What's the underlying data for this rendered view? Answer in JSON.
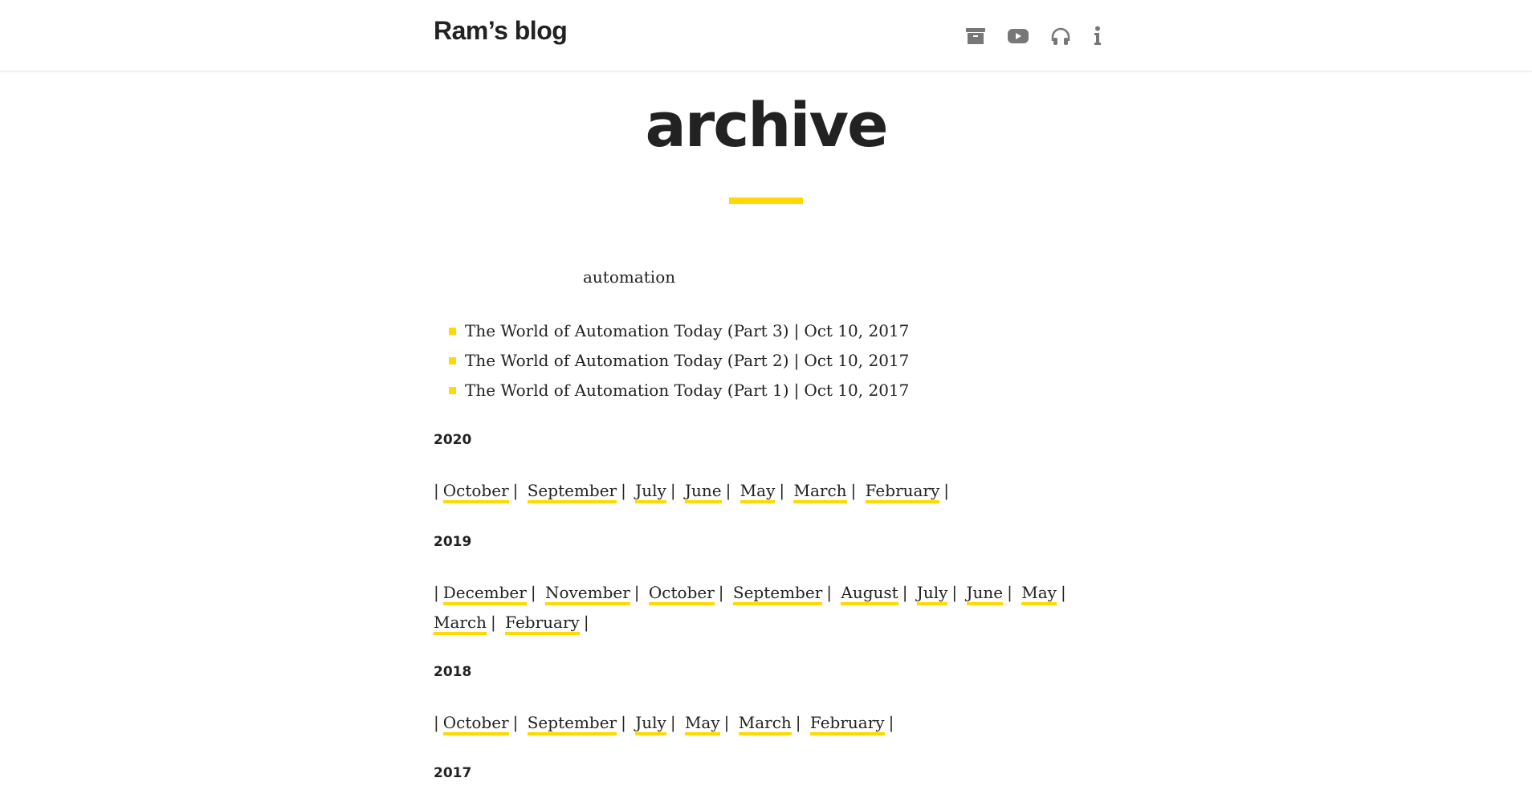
{
  "header": {
    "site_title": "Ram’s blog",
    "nav_icons": [
      {
        "name": "archive-icon",
        "label": "Archive"
      },
      {
        "name": "youtube-icon",
        "label": "YouTube"
      },
      {
        "name": "headphones-icon",
        "label": "Podcast"
      },
      {
        "name": "info-icon",
        "label": "About"
      }
    ],
    "icon_color": "#777777"
  },
  "page": {
    "title": "archive",
    "accent_color": "#ffd900"
  },
  "tag_section": {
    "label": "automation",
    "posts": [
      {
        "title": "The World of Automation Today (Part 3)",
        "date": "Oct 10, 2017"
      },
      {
        "title": "The World of Automation Today (Part 2)",
        "date": "Oct 10, 2017"
      },
      {
        "title": "The World of Automation Today (Part 1)",
        "date": "Oct 10, 2017"
      }
    ],
    "separator": "|"
  },
  "years": [
    {
      "year": "2020",
      "months": [
        "October",
        "September",
        "July",
        "June",
        "May",
        "March",
        "February"
      ]
    },
    {
      "year": "2019",
      "months": [
        "December",
        "November",
        "October",
        "September",
        "August",
        "July",
        "June",
        "May",
        "March",
        "February"
      ]
    },
    {
      "year": "2018",
      "months": [
        "October",
        "September",
        "July",
        "May",
        "March",
        "February"
      ]
    },
    {
      "year": "2017",
      "months": []
    }
  ]
}
